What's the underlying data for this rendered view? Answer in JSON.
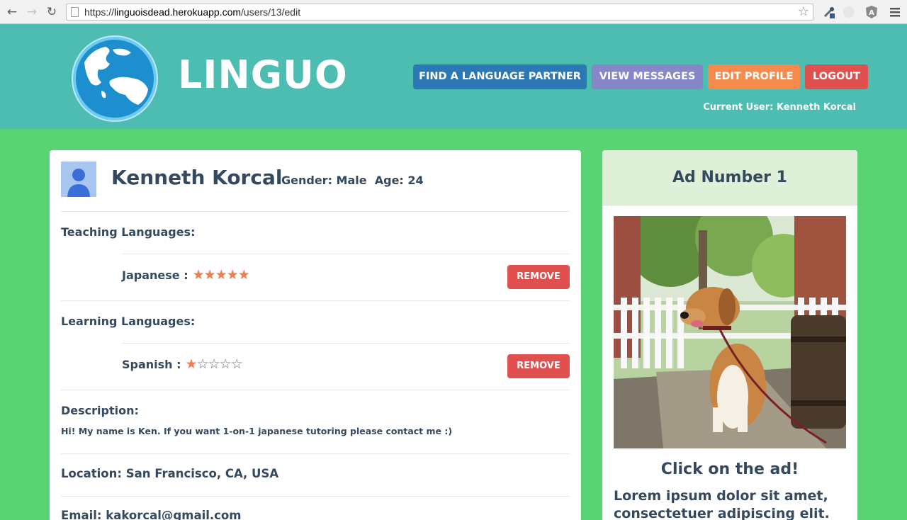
{
  "browser": {
    "url_prefix": "https://",
    "url_host": "linguoisdead.herokuapp.com",
    "url_path": "/users/13/edit"
  },
  "header": {
    "brand": "LINGUO",
    "nav": {
      "find_partner": "FIND A LANGUAGE PARTNER",
      "view_messages": "VIEW MESSAGES",
      "edit_profile": "EDIT PROFILE",
      "logout": "LOGOUT"
    },
    "current_user": "Current User: Kenneth Korcal"
  },
  "profile": {
    "name": "Kenneth Korcal",
    "meta": "Gender: Male  Age: 24",
    "teaching_label": "Teaching Languages:",
    "teaching": [
      {
        "language": "Japanese :",
        "rating": 5,
        "max": 5,
        "remove_label": "REMOVE"
      }
    ],
    "learning_label": "Learning Languages:",
    "learning": [
      {
        "language": "Spanish :",
        "rating": 1,
        "max": 5,
        "remove_label": "REMOVE"
      }
    ],
    "description_label": "Description:",
    "description": "Hi! My name is Ken. If you want 1-on-1 japanese tutoring please contact me :)",
    "location": "Location: San Francisco, CA, USA",
    "email": "Email: kakorcal@gmail.com"
  },
  "ad": {
    "title": "Ad Number 1",
    "cta": "Click on the ad!",
    "body": "Lorem ipsum dolor sit amet, consectetuer adipiscing elit."
  },
  "colors": {
    "page_bg": "#5ad374",
    "header_bg": "#4dbcb1",
    "find_btn": "#2b78b4",
    "messages_btn": "#8686c9",
    "edit_btn": "#f58b4c",
    "logout_btn": "#e0504f",
    "star": "#f07d4f"
  }
}
